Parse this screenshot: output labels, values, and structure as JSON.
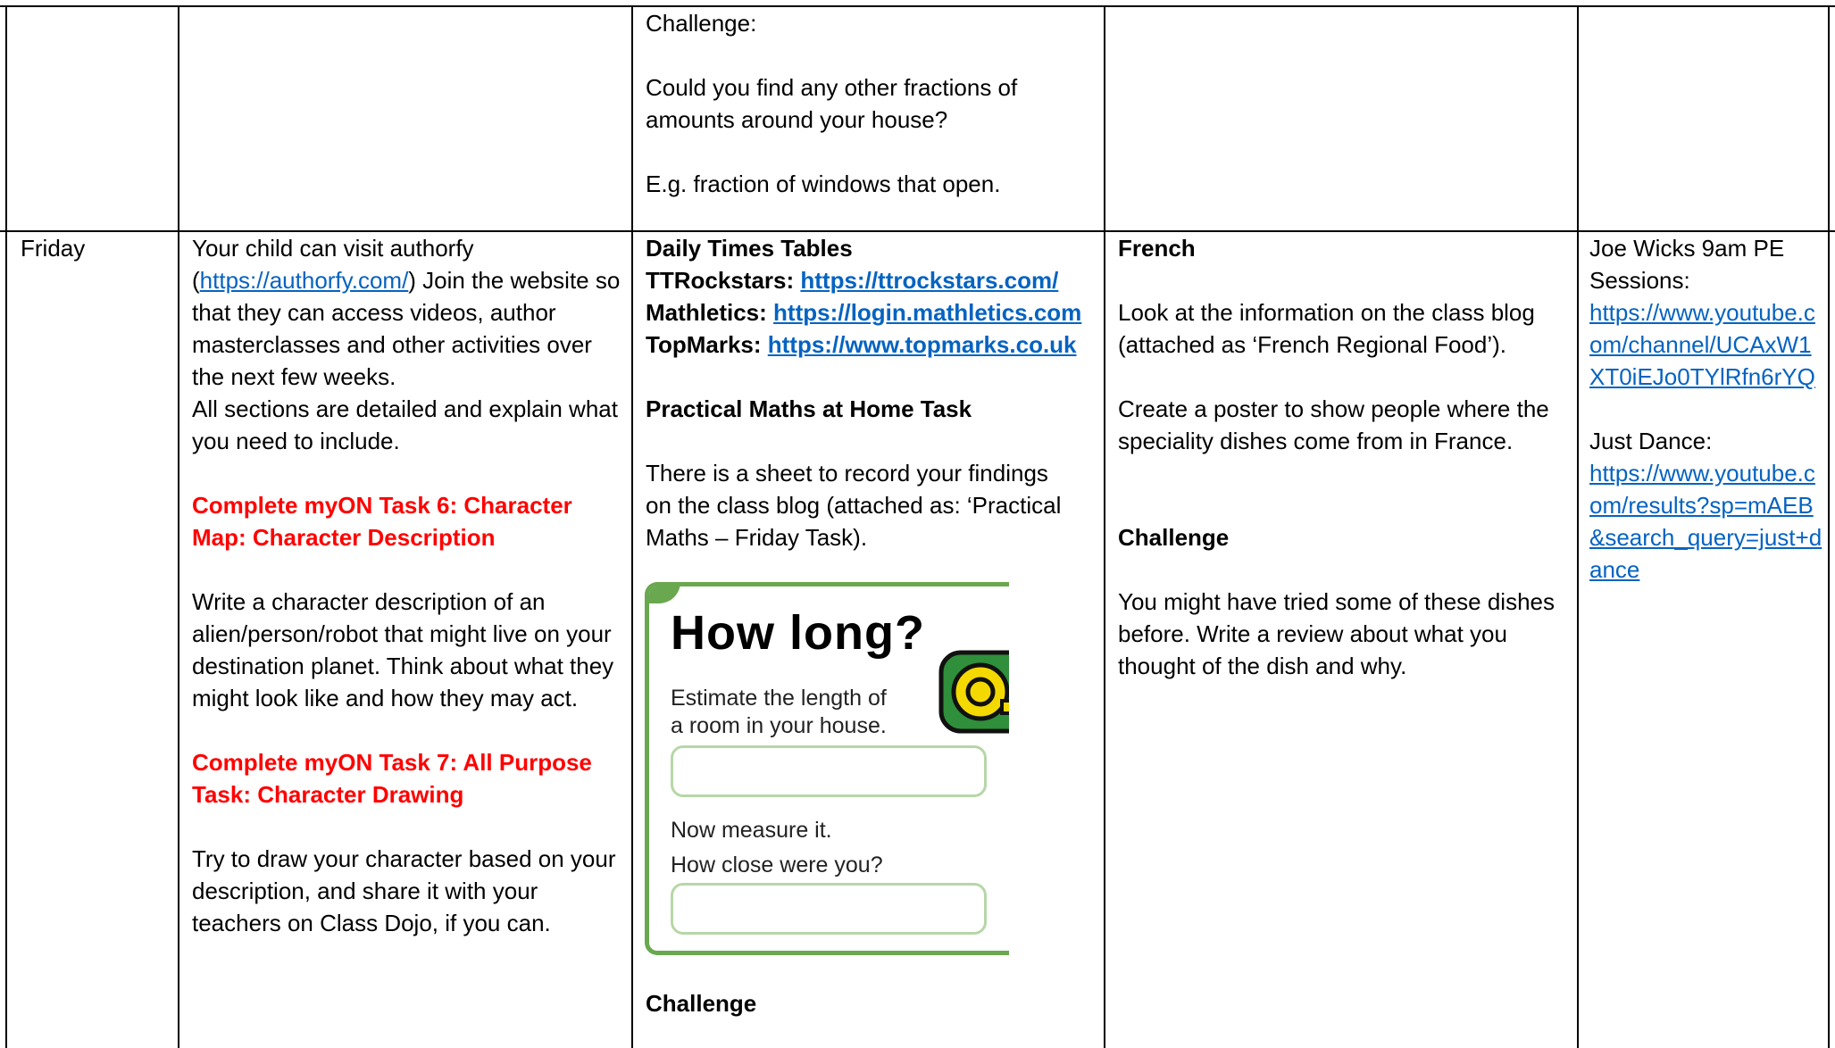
{
  "top_row": {
    "maths": {
      "challenge_label": "Challenge:",
      "question": "Could you find any other fractions of amounts around your house?",
      "example": "E.g. fraction of windows that open."
    }
  },
  "friday": {
    "day_label": "Friday",
    "english": {
      "intro_start": "Your child can visit authorfy (",
      "intro_link": "https://authorfy.com/",
      "intro_end": ") Join the website so that they can access videos, author masterclasses and other activities over the next few weeks.",
      "intro_detail": "All sections are detailed and explain what you need to include.",
      "task6_heading": "Complete myON Task 6: Character Map: Character Description",
      "task6_body": "Write a character description of an alien/person/robot that might live on your destination planet. Think about what they might look like and how they may act.",
      "task7_heading": "Complete myON Task 7: All Purpose Task: Character Drawing",
      "task7_body": "Try to draw your character based on your description, and share it with your teachers on Class Dojo, if you can."
    },
    "maths": {
      "times_tables_heading": "Daily Times Tables",
      "links": [
        {
          "label": "TTRockstars:",
          "url": "https://ttrockstars.com/"
        },
        {
          "label": "Mathletics:",
          "url": "https://login.mathletics.com"
        },
        {
          "label": "TopMarks:",
          "url": "https://www.topmarks.co.uk"
        }
      ],
      "practical_heading": "Practical Maths at Home Task",
      "practical_body": "There is a sheet to record your findings on the class blog (attached as: ‘Practical Maths – Friday Task).",
      "worksheet": {
        "title": "How long?",
        "estimate_text": "Estimate the length of a room in your house.",
        "measure_text": "Now measure it.",
        "close_text": "How close were you?",
        "icon": "tape-measure-icon"
      },
      "challenge_heading": "Challenge"
    },
    "french": {
      "heading": "French",
      "body1": "Look at the information on the class blog (attached as ‘French Regional Food’).",
      "body2": "Create a poster to show people where the speciality dishes come from in France.",
      "challenge_heading": "Challenge",
      "challenge_body": "You might have tried some of these dishes before. Write a review about what you thought of the dish and why."
    },
    "pe": {
      "joe_label": "Joe Wicks 9am PE Sessions:",
      "joe_link": "https://www.youtube.com/channel/UCAxW1XT0iEJo0TYlRfn6rYQ",
      "dance_label": "Just Dance:",
      "dance_link": "https://www.youtube.com/results?sp=mAEB&search_query=just+dance"
    }
  },
  "colors": {
    "link": "#0563c1",
    "task_heading": "#ff0000",
    "worksheet_green": "#6aa84f"
  }
}
